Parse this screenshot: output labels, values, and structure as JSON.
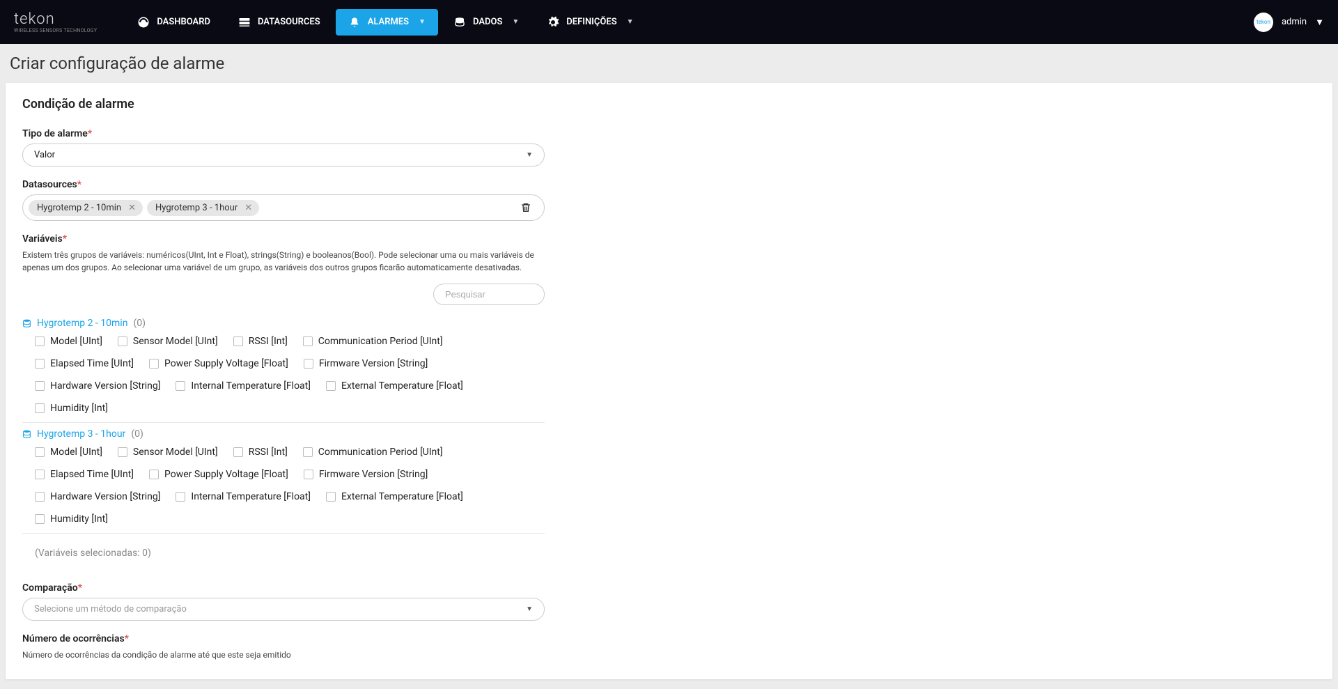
{
  "brand": {
    "name": "tekon",
    "tagline": "WIRELESS SENSORS TECHNOLOGY"
  },
  "nav": {
    "dashboard": "DASHBOARD",
    "datasources": "DATASOURCES",
    "alarmes": "ALARMES",
    "dados": "DADOS",
    "definicoes": "DEFINIÇÕES"
  },
  "user": {
    "name": "admin"
  },
  "page_title": "Criar configuração de alarme",
  "section": {
    "title": "Condição de alarme",
    "tipo_label": "Tipo de alarme",
    "tipo_value": "Valor",
    "datasources_label": "Datasources",
    "datasources_tags": [
      "Hygrotemp 2 - 10min",
      "Hygrotemp 3 - 1hour"
    ],
    "variaveis_label": "Variáveis",
    "variaveis_help": "Existem três grupos de variáveis: numéricos(UInt, Int e Float), strings(String) e booleanos(Bool). Pode selecionar uma ou mais variáveis de apenas um dos grupos. Ao selecionar uma variável de um grupo, as variáveis dos outros grupos ficarão automaticamente desativadas.",
    "search_placeholder": "Pesquisar",
    "groups": [
      {
        "name": "Hygrotemp 2 - 10min",
        "count": "(0)",
        "vars": [
          "Model [UInt]",
          "Sensor Model [UInt]",
          "RSSI [Int]",
          "Communication Period [UInt]",
          "Elapsed Time [UInt]",
          "Power Supply Voltage [Float]",
          "Firmware Version [String]",
          "Hardware Version [String]",
          "Internal Temperature [Float]",
          "External Temperature [Float]",
          "Humidity [Int]"
        ]
      },
      {
        "name": "Hygrotemp 3 - 1hour",
        "count": "(0)",
        "vars": [
          "Model [UInt]",
          "Sensor Model [UInt]",
          "RSSI [Int]",
          "Communication Period [UInt]",
          "Elapsed Time [UInt]",
          "Power Supply Voltage [Float]",
          "Firmware Version [String]",
          "Hardware Version [String]",
          "Internal Temperature [Float]",
          "External Temperature [Float]",
          "Humidity [Int]"
        ]
      }
    ],
    "selected_vars": "(Variáveis selecionadas: 0)",
    "comparacao_label": "Comparação",
    "comparacao_placeholder": "Selecione um método de comparação",
    "ocorrencias_label": "Número de ocorrências",
    "ocorrencias_help": "Número de ocorrências da condição de alarme até que este seja emitido"
  }
}
